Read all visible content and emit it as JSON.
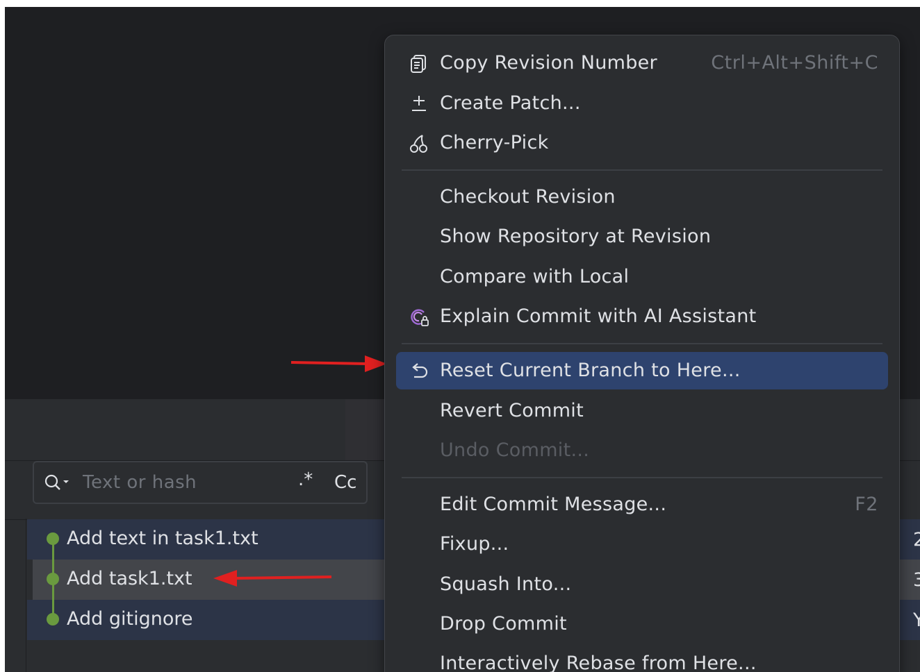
{
  "menu": {
    "items": [
      {
        "label": "Copy Revision Number",
        "shortcut": "Ctrl+Alt+Shift+C",
        "icon": "copy-icon"
      },
      {
        "label": "Create Patch...",
        "icon": "patch-icon"
      },
      {
        "label": "Cherry-Pick",
        "icon": "cherry-icon"
      },
      {
        "label": "Checkout Revision"
      },
      {
        "label": "Show Repository at Revision"
      },
      {
        "label": "Compare with Local"
      },
      {
        "label": "Explain Commit with AI Assistant",
        "icon": "ai-assistant-icon"
      },
      {
        "label": "Reset Current Branch to Here...",
        "icon": "reset-icon"
      },
      {
        "label": "Revert Commit"
      },
      {
        "label": "Undo Commit..."
      },
      {
        "label": "Edit Commit Message...",
        "shortcut": "F2"
      },
      {
        "label": "Fixup..."
      },
      {
        "label": "Squash Into..."
      },
      {
        "label": "Drop Commit"
      },
      {
        "label": "Interactively Rebase from Here..."
      }
    ]
  },
  "search": {
    "placeholder": "Text or hash",
    "regex_label": ".*",
    "case_label": "Cc"
  },
  "commits": [
    {
      "message": "Add text in task1.txt"
    },
    {
      "message": "Add task1.txt"
    },
    {
      "message": "Add gitignore"
    }
  ],
  "right_edge": [
    "2",
    "3",
    "Y"
  ],
  "colors": {
    "accent": "#2e436e",
    "graph": "#6a9a3f",
    "annotation_arrow": "#e02020"
  }
}
